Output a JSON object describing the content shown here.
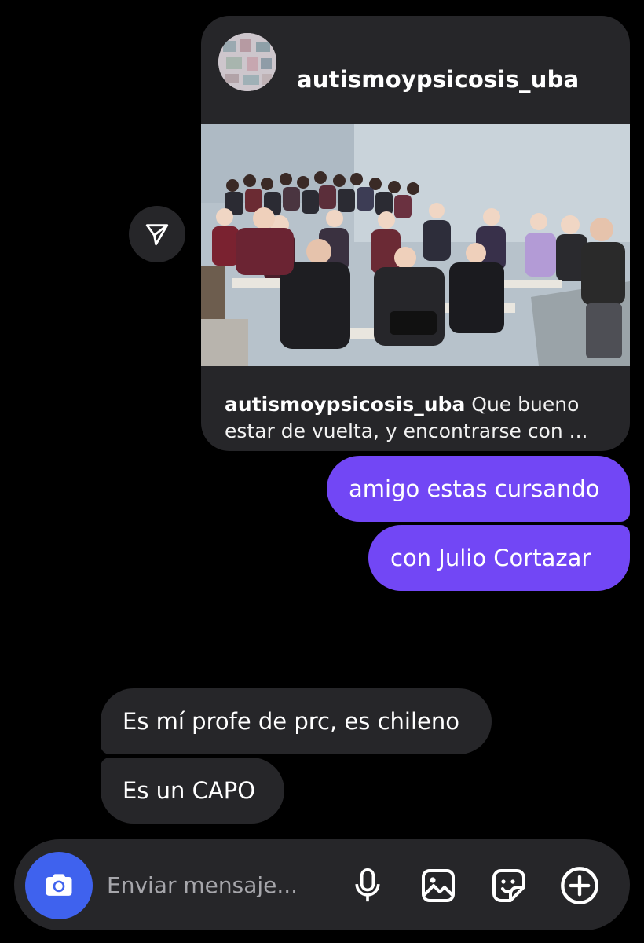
{
  "post": {
    "username": "autismoypsicosis_uba",
    "caption_username": "autismoypsicosis_uba",
    "caption_text_line1": " Que bueno",
    "caption_text_line2": "estar de vuelta, y encontrarse con ..."
  },
  "messages": [
    {
      "id": "b1",
      "direction": "sent",
      "text": "amigo estas cursando"
    },
    {
      "id": "b2",
      "direction": "sent",
      "text": "con Julio Cortazar"
    },
    {
      "id": "b3",
      "direction": "received",
      "text": "Es mí profe de prc, es chileno"
    },
    {
      "id": "b4",
      "direction": "received",
      "text": "Es un CAPO"
    }
  ],
  "composer": {
    "placeholder": "Enviar mensaje...",
    "value": ""
  },
  "icons": {
    "share": "send-icon",
    "camera": "camera-icon",
    "mic": "microphone-icon",
    "gallery": "gallery-icon",
    "sticker": "sticker-icon",
    "add": "plus-icon"
  },
  "colors": {
    "background": "#000000",
    "bubble_sent": "#7247f5",
    "bubble_received": "#262629",
    "camera_button": "#3f62ee",
    "placeholder": "#a6a6ab"
  }
}
